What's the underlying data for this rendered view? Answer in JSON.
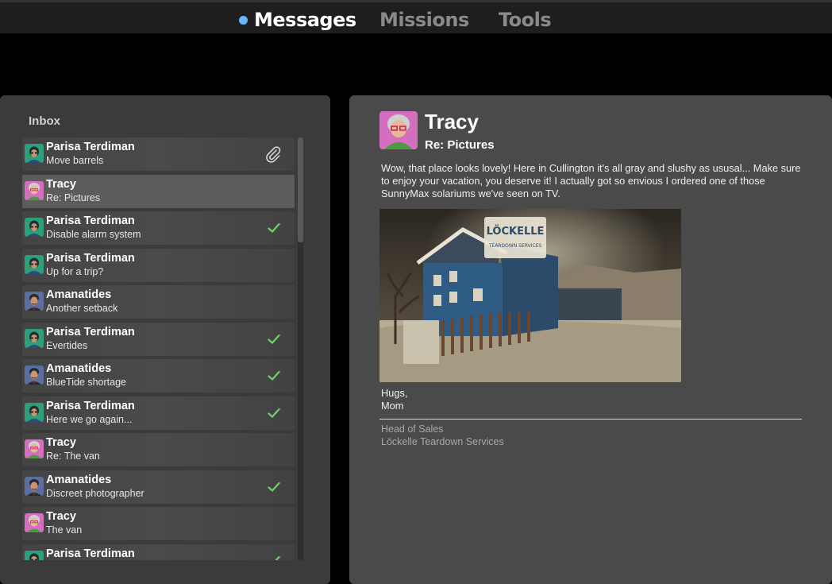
{
  "nav": {
    "tabs": [
      {
        "label": "Messages",
        "active": true
      },
      {
        "label": "Missions",
        "active": false
      },
      {
        "label": "Tools",
        "active": false
      }
    ],
    "active_dot_color": "#69b4ff"
  },
  "inbox": {
    "title": "Inbox",
    "messages": [
      {
        "sender": "Parisa Terdiman",
        "subject": "Move barrels",
        "avatar": "parisa-avatar",
        "status": "attachment-icon"
      },
      {
        "sender": "Tracy",
        "subject": "Re: Pictures",
        "avatar": "tracy-avatar",
        "status": "",
        "selected": true
      },
      {
        "sender": "Parisa Terdiman",
        "subject": "Disable alarm system",
        "avatar": "parisa-avatar",
        "status": "check-icon"
      },
      {
        "sender": "Parisa Terdiman",
        "subject": "Up for a trip?",
        "avatar": "parisa-avatar",
        "status": ""
      },
      {
        "sender": "Amanatides",
        "subject": "Another setback",
        "avatar": "amanatides-avatar",
        "status": ""
      },
      {
        "sender": "Parisa Terdiman",
        "subject": "Evertides",
        "avatar": "parisa-avatar",
        "status": "check-icon"
      },
      {
        "sender": "Amanatides",
        "subject": "BlueTide shortage",
        "avatar": "amanatides-avatar",
        "status": "check-icon"
      },
      {
        "sender": "Parisa Terdiman",
        "subject": "Here we go again...",
        "avatar": "parisa-avatar",
        "status": "check-icon"
      },
      {
        "sender": "Tracy",
        "subject": "Re: The van",
        "avatar": "tracy-avatar",
        "status": ""
      },
      {
        "sender": "Amanatides",
        "subject": "Discreet photographer",
        "avatar": "amanatides-avatar",
        "status": "check-icon"
      },
      {
        "sender": "Tracy",
        "subject": "The van",
        "avatar": "tracy-avatar",
        "status": ""
      },
      {
        "sender": "Parisa Terdiman",
        "subject": "",
        "avatar": "parisa-avatar",
        "status": "check-icon"
      }
    ],
    "check_color": "#6fcf6f"
  },
  "reader": {
    "sender": "Tracy",
    "subject": "Re: Pictures",
    "body": "Wow, that place looks lovely! Here in Cullington it's all gray and slushy as ususal... Make sure to enjoy your vacation, you deserve it! I actually got so envious I ordered one of those SunnyMax solariums we've seen on TV.",
    "photo_sign_line1": "LÖCKELLE",
    "photo_sign_line2": "TEARDOWN SERVICES",
    "signoff_line1": "Hugs,",
    "signoff_line2": "Mom",
    "sig_line1": "Head of Sales",
    "sig_line2": "Löckelle Teardown Services"
  }
}
